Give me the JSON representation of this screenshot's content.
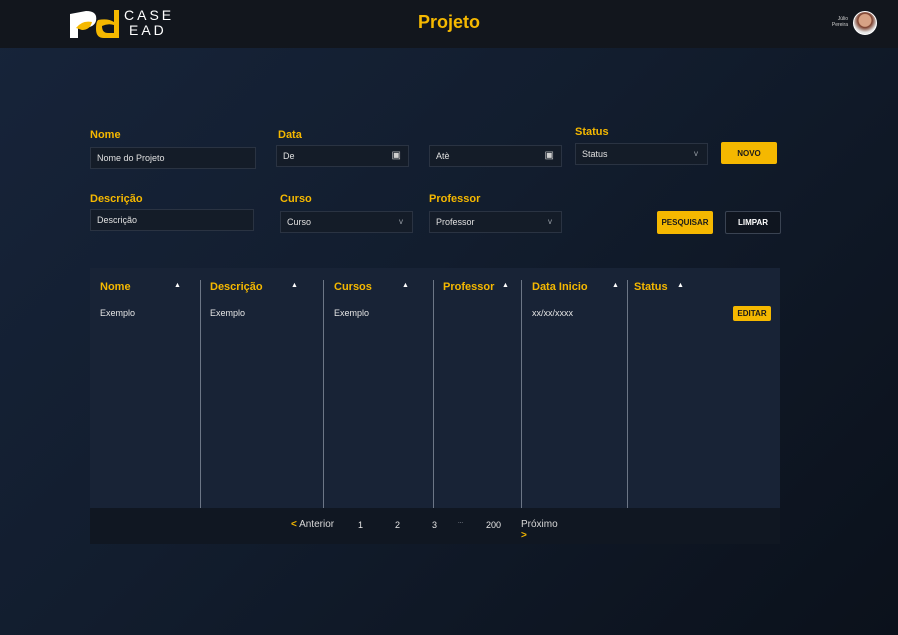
{
  "header": {
    "logo_text_line1": "CASE",
    "logo_text_line2": "EAD",
    "title": "Projeto",
    "user_name": "Júlio Pereira"
  },
  "filters": {
    "nome_label": "Nome",
    "nome_value": "Nome do Projeto",
    "data_label": "Data",
    "data_de": "De",
    "data_ate": "Atè",
    "status_label": "Status",
    "status_value": "Status",
    "novo_button": "NOVO",
    "descricao_label": "Descrição",
    "descricao_value": "Descrição",
    "curso_label": "Curso",
    "curso_value": "Curso",
    "professor_label": "Professor",
    "professor_value": "Professor",
    "pesquisar_button": "PESQUISAR",
    "limpar_button": "LIMPAR"
  },
  "table": {
    "columns": [
      "Nome",
      "Descrição",
      "Cursos",
      "Professor",
      "Data Inicio",
      "Status"
    ],
    "rows": [
      {
        "nome": "Exemplo",
        "descricao": "Exemplo",
        "cursos": "Exemplo",
        "professor": "",
        "data_inicio": "xx/xx/xxxx",
        "status": "",
        "action": "EDITAR"
      }
    ]
  },
  "pagination": {
    "prev_arrow": "<",
    "prev_label": "Anterior",
    "pages": [
      "1",
      "2",
      "3"
    ],
    "ellipsis": "...",
    "last_page": "200",
    "next_label": "Próximo",
    "next_arrow": ">"
  },
  "colors": {
    "accent": "#f5b800",
    "header_bg": "#12161d",
    "table_bg": "#182336"
  },
  "icons": {
    "calendar": "calendar-icon",
    "chevron": "chevron-down-icon",
    "sort": "sort-up-icon"
  }
}
